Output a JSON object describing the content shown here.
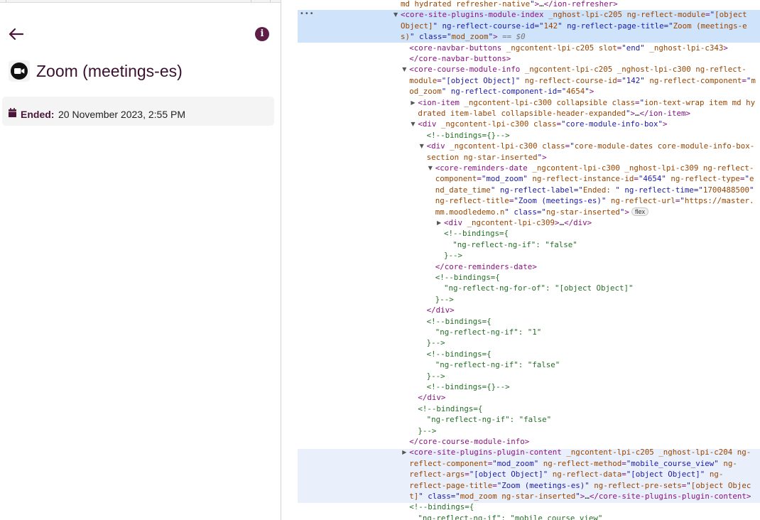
{
  "app": {
    "page_title": "Zoom (meetings-es)",
    "info_glyph": "i",
    "dates": {
      "label": "Ended:",
      "value": "20 November 2023, 2:55 PM"
    },
    "brand_color": "#5e1f47"
  },
  "devtools": {
    "dots": "•••",
    "lines": [
      {
        "indent": 0,
        "tri": "",
        "html": "md hydrated refresher-native\">…</ion-refresher>"
      },
      {
        "indent": 0,
        "tri": "open",
        "html": "<core-site-plugins-module-index _nghost-lpi-c205 ng-reflect-module=\"[object"
      },
      {
        "indent": 0,
        "tri": "",
        "html": "Object]\" ng-reflect-course-id=\"142\" ng-reflect-page-title=\"Zoom (meetings-e"
      },
      {
        "indent": 0,
        "tri": "",
        "html": "s)\" class=\"mod_zoom\"> == $0"
      },
      {
        "indent": 1,
        "tri": "",
        "html": "<core-navbar-buttons _ngcontent-lpi-c205 slot=\"end\" _nghost-lpi-c343>"
      },
      {
        "indent": 1,
        "tri": "",
        "html": "</core-navbar-buttons>"
      },
      {
        "indent": 1,
        "tri": "open",
        "html": "<core-course-module-info _ngcontent-lpi-c205 _nghost-lpi-c300 ng-reflect-"
      },
      {
        "indent": 1,
        "tri": "",
        "html": "module=\"[object Object]\" ng-reflect-course-id=\"142\" ng-reflect-component=\"m"
      },
      {
        "indent": 1,
        "tri": "",
        "html": "od_zoom\" ng-reflect-component-id=\"4654\">"
      },
      {
        "indent": 2,
        "tri": "closed",
        "html": "<ion-item _ngcontent-lpi-c300 collapsible class=\"ion-text-wrap item md hy"
      },
      {
        "indent": 2,
        "tri": "",
        "html": "drated item-label collapsible-header-expanded\">…</ion-item>"
      },
      {
        "indent": 2,
        "tri": "open",
        "html": "<div _ngcontent-lpi-c300 class=\"core-module-info-box\">"
      },
      {
        "indent": 3,
        "tri": "",
        "html": "<!--bindings={}-->"
      },
      {
        "indent": 3,
        "tri": "open",
        "html": "<div _ngcontent-lpi-c300 class=\"core-module-dates core-module-info-box-"
      },
      {
        "indent": 3,
        "tri": "",
        "html": "section ng-star-inserted\">"
      },
      {
        "indent": 4,
        "tri": "open",
        "html": "<core-reminders-date _ngcontent-lpi-c300 _nghost-lpi-c309 ng-reflect-"
      },
      {
        "indent": 4,
        "tri": "",
        "html": "component=\"mod_zoom\" ng-reflect-instance-id=\"4654\" ng-reflect-type=\"e"
      },
      {
        "indent": 4,
        "tri": "",
        "html": "nd_date_time\" ng-reflect-label=\"Ended: \" ng-reflect-time=\"1700488500\""
      },
      {
        "indent": 4,
        "tri": "",
        "html": "ng-reflect-title=\"Zoom (meetings-es)\" ng-reflect-url=\"https://master."
      },
      {
        "indent": 4,
        "tri": "",
        "html": "mm.moodledemo.n\" class=\"ng-star-inserted\">",
        "badge": "flex"
      },
      {
        "indent": 5,
        "tri": "closed",
        "html": "<div _ngcontent-lpi-c309>…</div>"
      },
      {
        "indent": 5,
        "tri": "",
        "html": "<!--bindings={"
      },
      {
        "indent": 6,
        "tri": "",
        "html": "\"ng-reflect-ng-if\": \"false\""
      },
      {
        "indent": 5,
        "tri": "",
        "html": "}-->"
      },
      {
        "indent": 4,
        "tri": "",
        "html": "</core-reminders-date>"
      },
      {
        "indent": 4,
        "tri": "",
        "html": "<!--bindings={"
      },
      {
        "indent": 5,
        "tri": "",
        "html": "\"ng-reflect-ng-for-of\": \"[object Object]\""
      },
      {
        "indent": 4,
        "tri": "",
        "html": "}-->"
      },
      {
        "indent": 3,
        "tri": "",
        "html": "</div>"
      },
      {
        "indent": 3,
        "tri": "",
        "html": "<!--bindings={"
      },
      {
        "indent": 4,
        "tri": "",
        "html": "\"ng-reflect-ng-if\": \"1\""
      },
      {
        "indent": 3,
        "tri": "",
        "html": "}-->"
      },
      {
        "indent": 3,
        "tri": "",
        "html": "<!--bindings={"
      },
      {
        "indent": 4,
        "tri": "",
        "html": "\"ng-reflect-ng-if\": \"false\""
      },
      {
        "indent": 3,
        "tri": "",
        "html": "}-->"
      },
      {
        "indent": 3,
        "tri": "",
        "html": "<!--bindings={}-->"
      },
      {
        "indent": 2,
        "tri": "",
        "html": "</div>"
      },
      {
        "indent": 2,
        "tri": "",
        "html": "<!--bindings={"
      },
      {
        "indent": 3,
        "tri": "",
        "html": "\"ng-reflect-ng-if\": \"false\""
      },
      {
        "indent": 2,
        "tri": "",
        "html": "}-->"
      },
      {
        "indent": 1,
        "tri": "",
        "html": "</core-course-module-info>"
      },
      {
        "indent": 1,
        "tri": "closed",
        "html": "<core-site-plugins-plugin-content _ngcontent-lpi-c205 _nghost-lpi-c204 ng-"
      },
      {
        "indent": 1,
        "tri": "",
        "html": "reflect-component=\"mod_zoom\" ng-reflect-method=\"mobile_course_view\" ng-"
      },
      {
        "indent": 1,
        "tri": "",
        "html": "reflect-args=\"[object Object]\" ng-reflect-data=\"[object Object]\" ng-"
      },
      {
        "indent": 1,
        "tri": "",
        "html": "reflect-page-title=\"Zoom (meetings-es)\" ng-reflect-pre-sets=\"[object Objec"
      },
      {
        "indent": 1,
        "tri": "",
        "html": "t]\" class=\"mod_zoom ng-star-inserted\">…</core-site-plugins-plugin-content>"
      },
      {
        "indent": 1,
        "tri": "",
        "html": "<!--bindings={"
      },
      {
        "indent": 2,
        "tri": "",
        "html": "\"ng-reflect-ng-if\": \"mobile_course_view\""
      }
    ]
  }
}
